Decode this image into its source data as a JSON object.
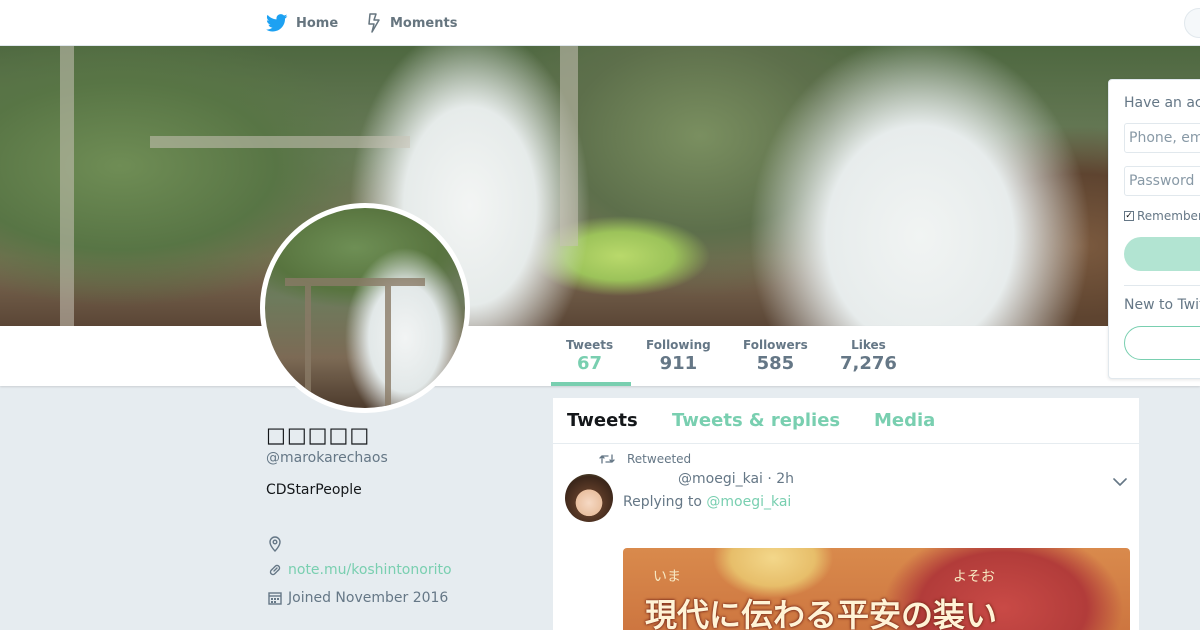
{
  "nav": {
    "home_label": "Home",
    "moments_label": "Moments"
  },
  "profile": {
    "name": "□□□□□",
    "handle": "@marokarechaos",
    "bio": "CDStarPeople",
    "website": "note.mu/koshintonorito",
    "joined": "Joined November 2016"
  },
  "stats": [
    {
      "label": "Tweets",
      "value": "67"
    },
    {
      "label": "Following",
      "value": "911"
    },
    {
      "label": "Followers",
      "value": "585"
    },
    {
      "label": "Likes",
      "value": "7,276"
    }
  ],
  "timeline": {
    "tabs": [
      "Tweets",
      "Tweets & replies",
      "Media"
    ],
    "tweet": {
      "retweeted_label": "Retweeted",
      "handle_time": "@moegi_kai · 2h",
      "reply_prefix": "Replying to",
      "reply_to": "@moegi_kai",
      "image_ruby_1": "いま",
      "image_ruby_2": "よそお",
      "image_caption": "現代に伝わる平安の装い"
    }
  },
  "login": {
    "heading": "Have an account?",
    "phone_placeholder": "Phone, email or username",
    "password_placeholder": "Password",
    "remember_label": "Remember me",
    "new_label": "New to Twitter?"
  },
  "colors": {
    "accent": "#79cfb0",
    "twitter_blue": "#1da1f2",
    "background": "#e6ecf0"
  }
}
